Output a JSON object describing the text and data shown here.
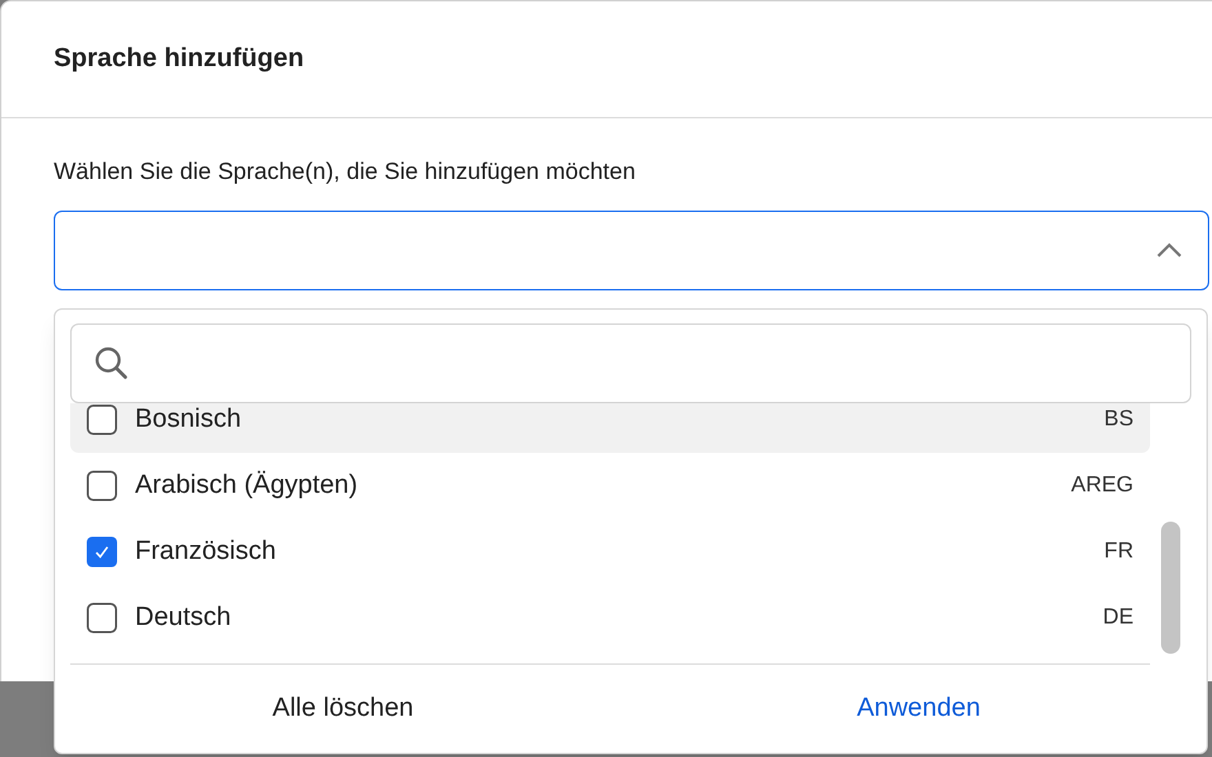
{
  "dialog": {
    "title": "Sprache hinzufügen"
  },
  "field": {
    "label": "Wählen Sie die Sprache(n), die Sie hinzufügen möchten",
    "expanded": true
  },
  "dropdown": {
    "options": [
      {
        "name": "Bosnisch",
        "code": "BS",
        "checked": false,
        "hovered": true
      },
      {
        "name": "Arabisch (Ägypten)",
        "code": "AREG",
        "checked": false,
        "hovered": false
      },
      {
        "name": "Französisch",
        "code": "FR",
        "checked": true,
        "hovered": false
      },
      {
        "name": "Deutsch",
        "code": "DE",
        "checked": false,
        "hovered": false
      }
    ],
    "buttons": [
      {
        "label": "Alle löschen",
        "kind": "secondary"
      },
      {
        "label": "Anwenden",
        "kind": "primary"
      }
    ]
  }
}
